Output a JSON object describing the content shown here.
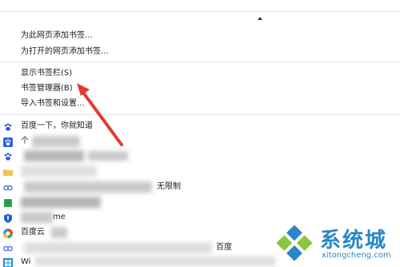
{
  "menu": {
    "items": [
      {
        "label": "为此网页添加书签..."
      },
      {
        "label": "为打开的网页添加书签..."
      },
      {
        "label": "显示书签栏(S)"
      },
      {
        "label": "书签管理器(B)"
      },
      {
        "label": "导入书签和设置..."
      }
    ]
  },
  "bookmarks": [
    {
      "label": "百度一下，你就知道",
      "icon": "baidu-paw-icon"
    },
    {
      "label": "个",
      "icon": "baidu-paw-icon"
    },
    {
      "label": "",
      "icon": "baidu-paw-icon"
    },
    {
      "label": "",
      "icon": "folder-icon"
    },
    {
      "label": "无限制",
      "icon": "link-icon"
    },
    {
      "label": "",
      "icon": "green-app-icon"
    },
    {
      "label": "",
      "icon": "shield-icon"
    },
    {
      "label": "me",
      "icon": "colorful-circle-icon"
    },
    {
      "label": "百度云",
      "icon": "cloud-icon"
    },
    {
      "label": "百度",
      "icon": "link-icon"
    },
    {
      "label": "Wi",
      "icon": "windows-icon"
    }
  ],
  "watermark": {
    "title": "系统城",
    "url": "xitongcheng.com",
    "icon": "xitongcheng-logo-icon",
    "color": "#2a86c8"
  },
  "annotation": {
    "icon": "red-pointer-arrow-icon",
    "color": "#e53935"
  }
}
